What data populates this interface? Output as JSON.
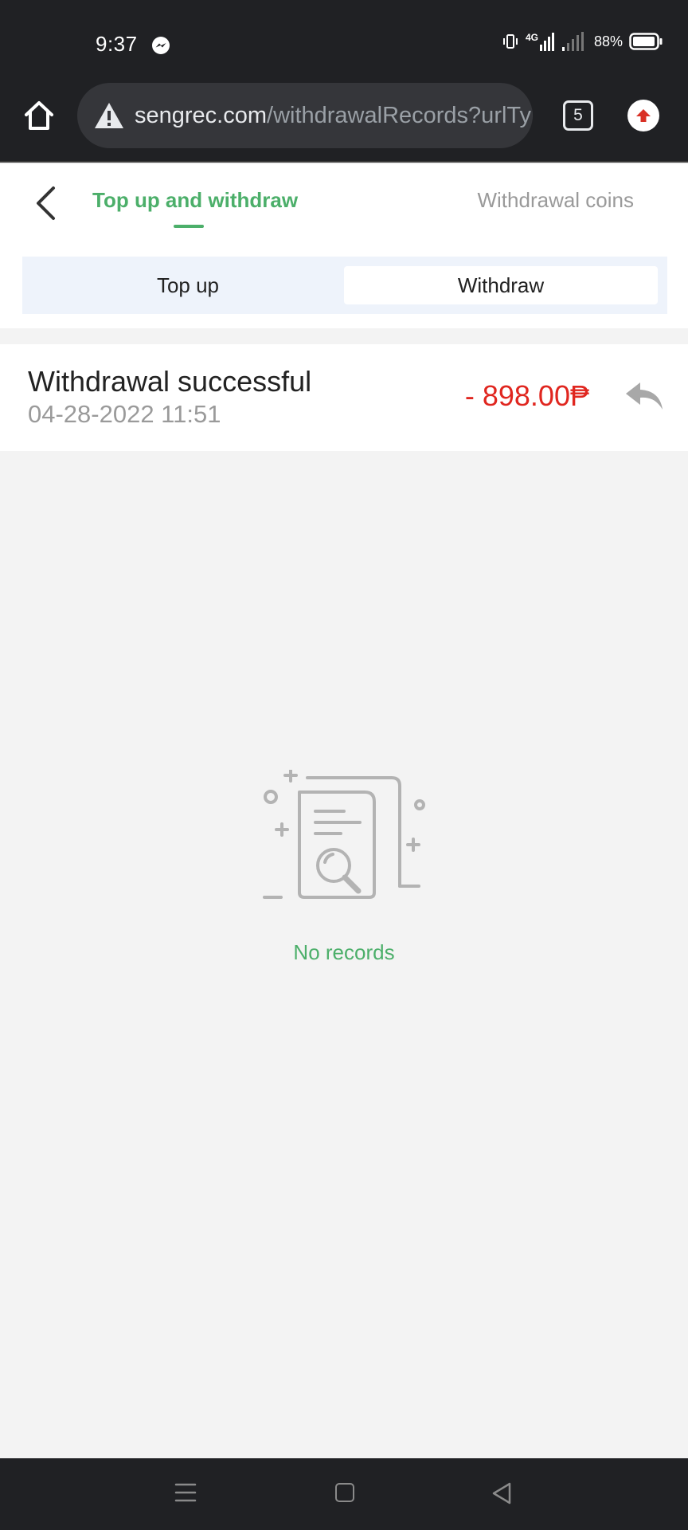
{
  "status_bar": {
    "time": "9:37",
    "network": "4G",
    "battery": "88%",
    "icons": [
      "messenger-icon",
      "vibrate-icon",
      "mobile-data-icon",
      "signal-icon",
      "battery-icon"
    ]
  },
  "browser": {
    "url_host": "sengrec.com",
    "url_path": "/withdrawalRecords?urlTyp",
    "tab_count": "5",
    "icons": [
      "home-icon",
      "warning-icon",
      "tabs-icon",
      "update-icon"
    ]
  },
  "header": {
    "tabs": [
      {
        "label": "Top up and withdraw",
        "active": true
      },
      {
        "label": "Withdrawal coins",
        "active": false
      }
    ]
  },
  "segment": {
    "options": [
      {
        "label": "Top up",
        "selected": false
      },
      {
        "label": "Withdraw",
        "selected": true
      }
    ]
  },
  "records": [
    {
      "title": "Withdrawal successful",
      "date": "04-28-2022 11:51",
      "amount": "- 898.00₱",
      "icon": "reply-icon"
    }
  ],
  "empty": {
    "text": "No records"
  },
  "colors": {
    "accent_green": "#4caf6a",
    "amount_red": "#e0261f",
    "system_bar": "#202124"
  }
}
